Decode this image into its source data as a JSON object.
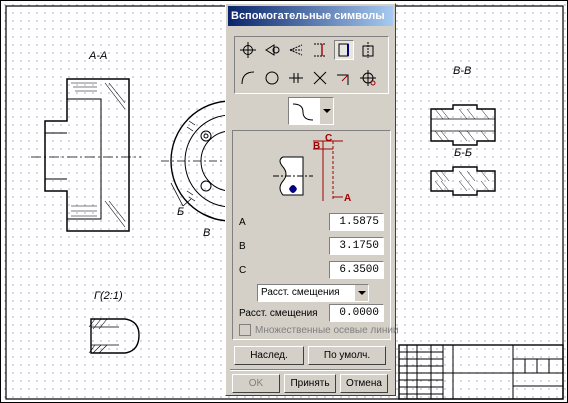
{
  "drawing": {
    "views": {
      "aa": "А-А",
      "vv": "В-В",
      "bb": "Б-Б",
      "g": "Г(2:1)",
      "b": "Б",
      "v": "В"
    }
  },
  "dialog": {
    "title": "Вспомогательные символы",
    "toolbar_icons": [
      "center-mark-icon",
      "cone-mark-icon",
      "arrow-mark-icon",
      "axis-line-icon",
      "thread-icon",
      "thread-section-icon",
      "arc-icon",
      "circle-icon",
      "break-line-icon",
      "cross-icon",
      "angle-icon",
      "hole-pattern-icon"
    ],
    "preview_labels": {
      "a": "A",
      "b": "B",
      "c": "C"
    },
    "params": [
      {
        "label": "A",
        "value": "1.5875"
      },
      {
        "label": "B",
        "value": "3.1750"
      },
      {
        "label": "C",
        "value": "6.3500"
      }
    ],
    "offset_combo": "Расст. смещения",
    "offset_label": "Расст. смещения",
    "offset_value": "0.0000",
    "multiple_axes_label": "Множественные осевые линии",
    "inherit_button": "Наслед.",
    "default_button": "По умолч.",
    "ok_button": "OK",
    "accept_button": "Принять",
    "cancel_button": "Отмена",
    "accent_color": "#0a246a",
    "dimension_color": "#a00000"
  }
}
